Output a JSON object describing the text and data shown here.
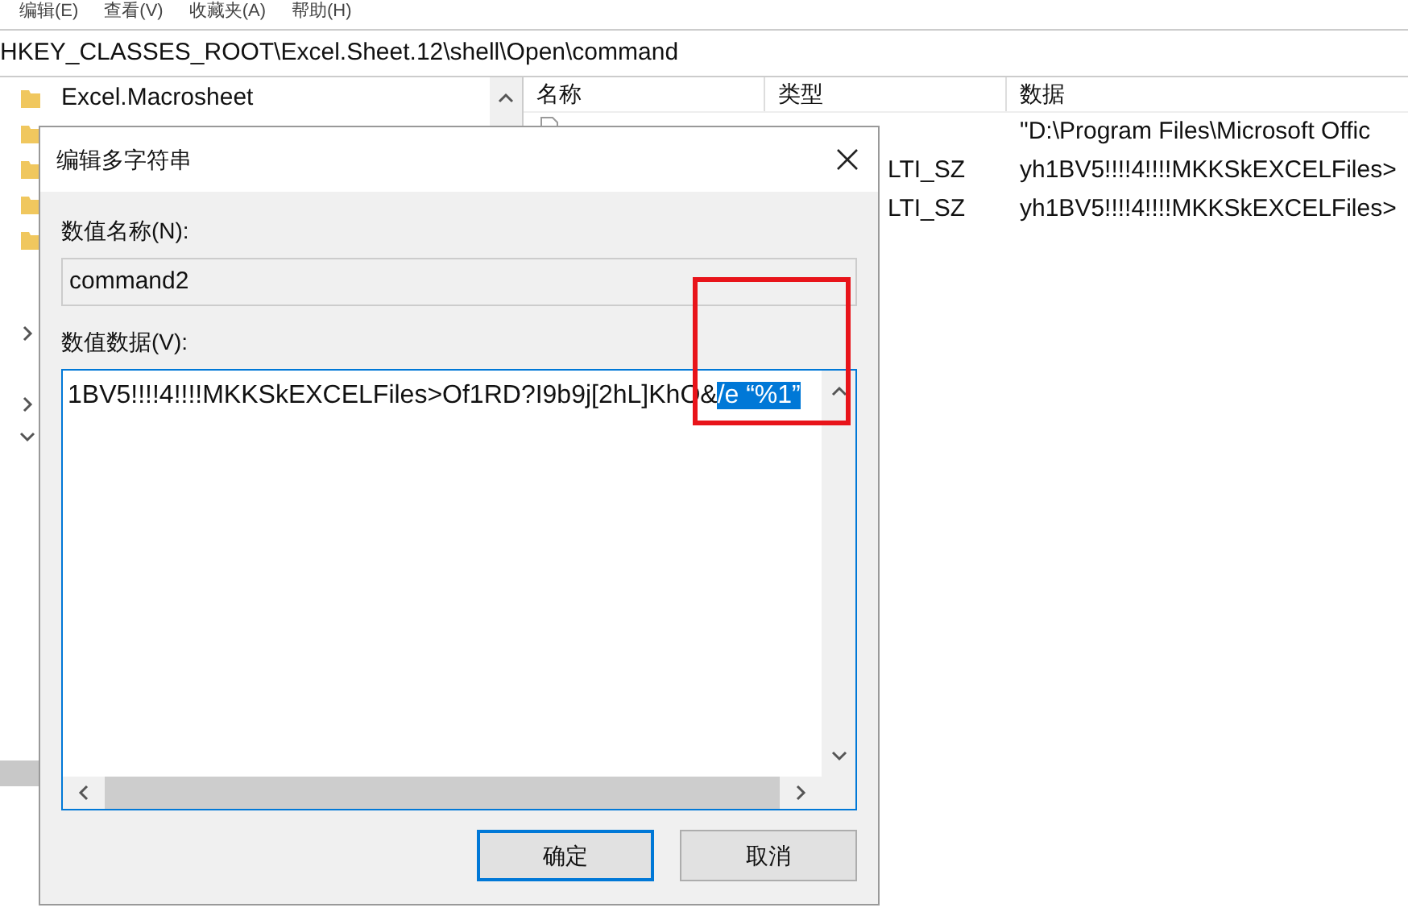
{
  "menu": [
    "编辑(E)",
    "查看(V)",
    "收藏夹(A)",
    "帮助(H)"
  ],
  "address": "HKEY_CLASSES_ROOT\\Excel.Sheet.12\\shell\\Open\\command",
  "tree": [
    {
      "label": "Excel.Macrosheet"
    }
  ],
  "list": {
    "columns": [
      "名称",
      "类型",
      "数据"
    ],
    "rows": [
      {
        "type": "",
        "data": "\"D:\\Program Files\\Microsoft Offic"
      },
      {
        "type": "LTI_SZ",
        "data": "yh1BV5!!!!4!!!!MKKSkEXCELFiles>"
      },
      {
        "type": "LTI_SZ",
        "data": "yh1BV5!!!!4!!!!MKKSkEXCELFiles>"
      }
    ]
  },
  "dialog": {
    "title": "编辑多字符串",
    "name_label": "数值名称(N):",
    "name_value": "command2",
    "data_label": "数值数据(V):",
    "data_text": "1BV5!!!!4!!!!MKKSkEXCELFiles>Of1RD?I9b9j[2hL]KhO&",
    "data_selected": "/e “%1”",
    "buttons": [
      {
        "label": "确定",
        "selected": true
      },
      {
        "label": "取消",
        "selected": false
      }
    ]
  }
}
